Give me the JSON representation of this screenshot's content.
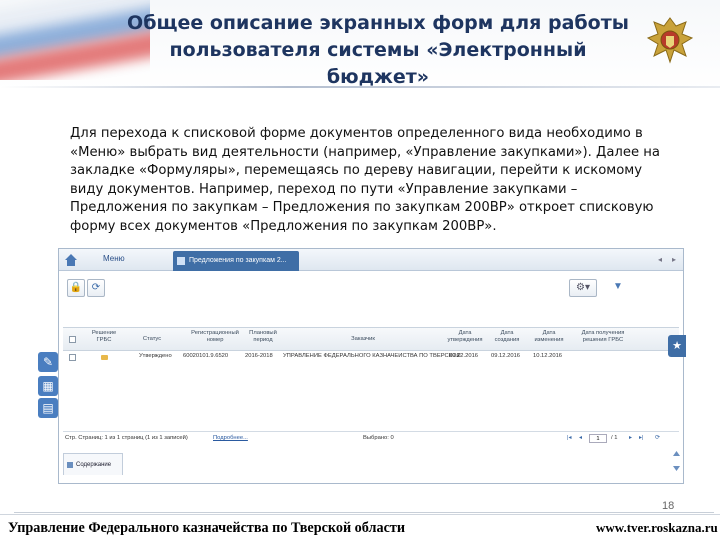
{
  "slide": {
    "title_line1": "Общее описание экранных форм для работы",
    "title_line2": "пользователя системы «Электронный бюджет»",
    "description": "Для перехода к списковой форме документов определенного вида необходимо в «Меню» выбрать вид деятельности (например, «Управление закупками»). Далее на закладке «Формуляры», перемещаясь по дереву навигации, перейти к искомому виду документов. Например, переход по пути «Управление закупками – Предложения по закупкам – Предложения по закупкам 200ВР» откроет списковую форму всех документов «Предложения по закупкам 200ВР».",
    "page_number": "18",
    "footer_org": "Управление Федерального казначейства по Тверской области",
    "footer_url": "www.tver.roskazna.ru"
  },
  "app": {
    "menu_label": "Меню",
    "active_tab": "Предложения по закупкам 2...",
    "columns": [
      "Решение ГРБС",
      "Статус",
      "Регистрационный номер",
      "Плановый период",
      "Заказчик",
      "Дата утверждения",
      "Дата создания",
      "Дата изменения",
      "Дата получения решения ГРБС"
    ],
    "rows": [
      {
        "status": "Утверждено",
        "reg_number": "60020101.9.6520",
        "period": "2016-2018",
        "customer": "УПРАВЛЕНИЕ ФЕДЕРАЛЬНОГО КАЗНАЧЕЙСТВА ПО ТВЕРСКОЙ ОБЛАСТИ",
        "approved_date": "09.12.2016",
        "created_date": "09.12.2016",
        "decision_date": "10.12.2016"
      }
    ],
    "pager": {
      "info": "Стр. Страниц: 1 из 1 страниц (1 из 1 записей)",
      "more": "Подробнее...",
      "selected": "Выбрано: 0",
      "page": "1",
      "total": "/ 1"
    },
    "bottom_tab": "Содержание"
  },
  "colors": {
    "title": "#1e3560",
    "accent": "#3f6ea6",
    "status_marker": "#e8b84a"
  }
}
